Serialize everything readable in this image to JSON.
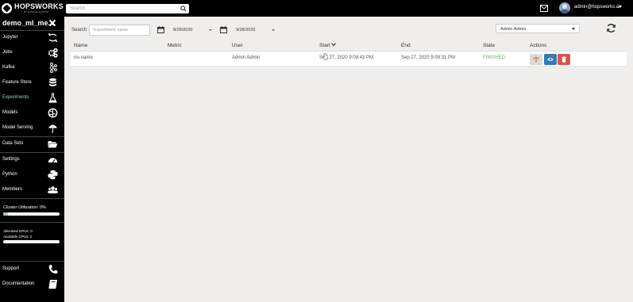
{
  "header": {
    "logo_name": "HOPSWORKS",
    "logo_tagline": "BY LOGICAL CLOCKS",
    "search_placeholder": "Search",
    "user_email": "admin@hopsworks.ai",
    "icons": [
      "search-icon",
      "mail-icon",
      "caret-down-icon"
    ]
  },
  "sidebar": {
    "project_name": "demo_ml_me...",
    "items": [
      {
        "label": "Jupyter",
        "icon": "jupyter-icon"
      },
      {
        "label": "Jobs",
        "icon": "gears-icon"
      },
      {
        "label": "Kafka",
        "icon": "kafka-icon"
      },
      {
        "label": "Feature Store",
        "icon": "database-icon"
      },
      {
        "label": "Experiments",
        "icon": "flask-icon",
        "active": true
      },
      {
        "label": "Models",
        "icon": "brain-icon"
      },
      {
        "label": "Model Serving",
        "icon": "umbrella-icon"
      },
      {
        "label": "Data Sets",
        "icon": "folder-open-icon"
      },
      {
        "label": "Settings",
        "icon": "dashboard-icon"
      },
      {
        "label": "Python",
        "icon": "python-icon"
      },
      {
        "label": "Members",
        "icon": "users-icon"
      }
    ],
    "cluster_utilization": "Cluster Utilization: 0%",
    "cluster_utilization_value": 0.08,
    "allocated_gpus": "Allocated GPUs: 0",
    "available_gpus": "Available GPUs: 2",
    "support_label": "Support",
    "documentation_label": "Documentation"
  },
  "filters": {
    "search_label": "Search",
    "experiment_placeholder": "Experiment name",
    "date_from": "8/28/2020",
    "date_to": "9/28/2020",
    "user_filter": "Admin Admin"
  },
  "table": {
    "columns": [
      "Name",
      "Metric",
      "User",
      "Start",
      "End",
      "State",
      "Actions"
    ],
    "rows": [
      {
        "name": "no-name",
        "metric": "",
        "user": "Admin Admin",
        "start": "Sep 27, 2020 9:08:43 PM",
        "end": "Sep 27, 2020 9:09:31 PM",
        "state": "FINISHED"
      }
    ]
  },
  "colors": {
    "topbar": "#000000",
    "sidebar": "#000000",
    "active_nav": "#9fd3a6",
    "state_finished": "#5cb85c",
    "tensorboard_button": "#d9d9d9",
    "view_button": "#337ab7",
    "delete_button": "#d9534f"
  }
}
